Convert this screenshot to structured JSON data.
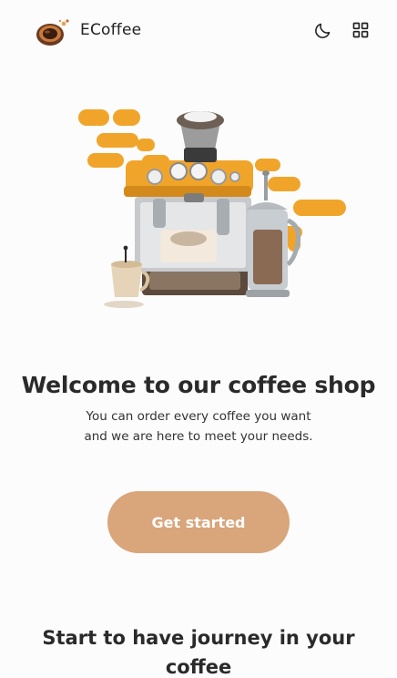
{
  "header": {
    "brand": "ECoffee",
    "logo_icon": "coffee-cup-logo-icon",
    "theme_toggle_icon": "moon-icon",
    "menu_icon": "grid-menu-icon"
  },
  "hero": {
    "illustration": "espresso-machine-illustration"
  },
  "welcome": {
    "title": "Welcome to our coffee shop",
    "subtitle_line1": "You can order every coffee you want",
    "subtitle_line2": "and we are here to meet your needs."
  },
  "cta": {
    "label": "Get started"
  },
  "journey": {
    "title": "Start to have journey in your coffee"
  },
  "colors": {
    "accent": "#d9a57b",
    "illustration_orange": "#f0a52a",
    "background": "#fcfcfc",
    "text": "#2a2a2a"
  }
}
